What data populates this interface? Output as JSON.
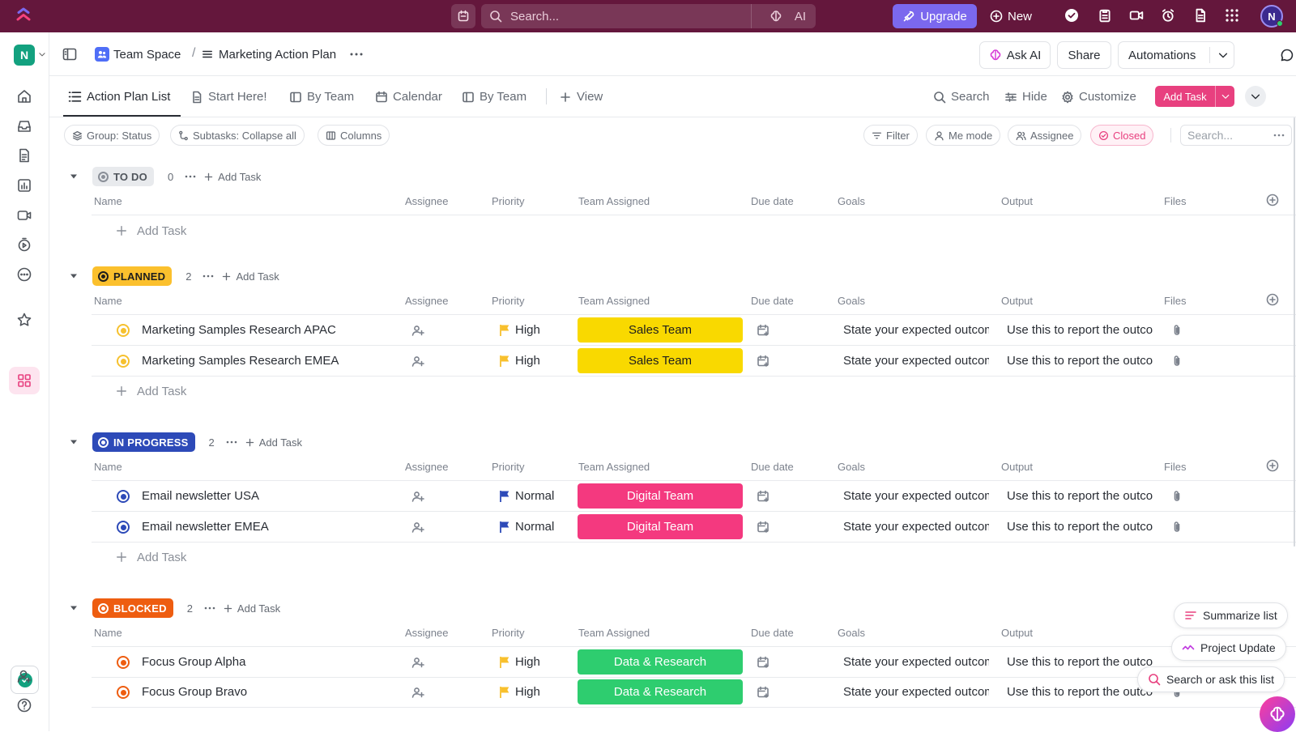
{
  "topbar": {
    "search_placeholder": "Search...",
    "ai_label": "AI",
    "upgrade_label": "Upgrade",
    "new_label": "New",
    "avatar_initial": "N",
    "brand_color": "#64173c"
  },
  "rail": {
    "workspace_initial": "N"
  },
  "header": {
    "space_name": "Team Space",
    "separator": "/",
    "list_name": "Marketing Action Plan",
    "ask_ai_label": "Ask AI",
    "share_label": "Share",
    "automations_label": "Automations"
  },
  "tabs": {
    "items": [
      {
        "label": "Action Plan List"
      },
      {
        "label": "Start Here!"
      },
      {
        "label": "By Team"
      },
      {
        "label": "Calendar"
      },
      {
        "label": "By Team"
      }
    ],
    "view_label": "View",
    "search_label": "Search",
    "hide_label": "Hide",
    "customize_label": "Customize",
    "add_task_label": "Add Task"
  },
  "filters": {
    "group_label": "Group: Status",
    "subtasks_label": "Subtasks: Collapse all",
    "columns_label": "Columns",
    "filter_label": "Filter",
    "me_mode_label": "Me mode",
    "assignee_label": "Assignee",
    "closed_label": "Closed",
    "search_placeholder": "Search..."
  },
  "columns": {
    "name": "Name",
    "assignee": "Assignee",
    "priority": "Priority",
    "team": "Team Assigned",
    "due": "Due date",
    "goals": "Goals",
    "output": "Output",
    "files": "Files"
  },
  "add_task_label": "Add Task",
  "groups": [
    {
      "status": "TO DO",
      "count": "0",
      "pill_bg": "#e8eaed",
      "pill_fg": "#50555c",
      "ring_color": "#8a8f98",
      "tasks": []
    },
    {
      "status": "PLANNED",
      "count": "2",
      "pill_bg": "#fbc02d",
      "pill_fg": "#1e1e1e",
      "ring_color": "#1e1e1e",
      "tasks": [
        {
          "name": "Marketing Samples Research APAC",
          "priority": "High",
          "flag_color": "#f8c02d",
          "team": "Sales Team",
          "team_bg": "#f9d900",
          "team_fg": "#1e1e1e",
          "goal": "State your expected outcome",
          "output": "Use this to report the outcome",
          "status_color": "#f6c12f"
        },
        {
          "name": "Marketing Samples Research EMEA",
          "priority": "High",
          "flag_color": "#f8c02d",
          "team": "Sales Team",
          "team_bg": "#f9d900",
          "team_fg": "#1e1e1e",
          "goal": "State your expected outcome",
          "output": "Use this to report the outcome",
          "status_color": "#f6c12f"
        }
      ]
    },
    {
      "status": "IN PROGRESS",
      "count": "2",
      "pill_bg": "#2d4ab8",
      "pill_fg": "#ffffff",
      "ring_color": "#ffffff",
      "tasks": [
        {
          "name": "Email newsletter USA",
          "priority": "Normal",
          "flag_color": "#2d4ab8",
          "team": "Digital Team",
          "team_bg": "#f4397f",
          "team_fg": "#ffffff",
          "goal": "State your expected outcome",
          "output": "Use this to report the outcome",
          "status_color": "#2d4ab8"
        },
        {
          "name": "Email newsletter EMEA",
          "priority": "Normal",
          "flag_color": "#2d4ab8",
          "team": "Digital Team",
          "team_bg": "#f4397f",
          "team_fg": "#ffffff",
          "goal": "State your expected outcome",
          "output": "Use this to report the outcome",
          "status_color": "#2d4ab8"
        }
      ]
    },
    {
      "status": "BLOCKED",
      "count": "2",
      "pill_bg": "#ee5d10",
      "pill_fg": "#ffffff",
      "ring_color": "#ffffff",
      "tasks": [
        {
          "name": "Focus Group Alpha",
          "priority": "High",
          "flag_color": "#f8c02d",
          "team": "Data & Research",
          "team_bg": "#2ecd6f",
          "team_fg": "#ffffff",
          "goal": "State your expected outcome",
          "output": "Use this to report the outcome",
          "status_color": "#ee5d10"
        },
        {
          "name": "Focus Group Bravo",
          "priority": "High",
          "flag_color": "#f8c02d",
          "team": "Data & Research",
          "team_bg": "#2ecd6f",
          "team_fg": "#ffffff",
          "goal": "State your expected outcome",
          "output": "Use this to report the outcome",
          "status_color": "#ee5d10"
        }
      ]
    }
  ],
  "floating": {
    "summarize_label": "Summarize list",
    "project_update_label": "Project Update",
    "ask_label": "Search or ask this list"
  }
}
